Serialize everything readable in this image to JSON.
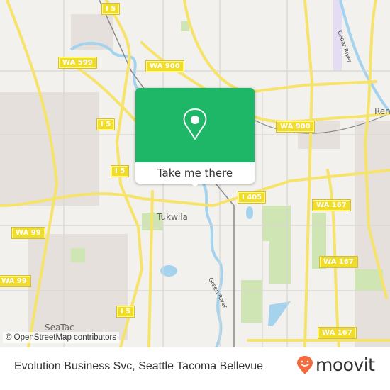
{
  "map": {
    "road_shields": [
      {
        "id": "i5-top",
        "label": "I 5"
      },
      {
        "id": "wa599",
        "label": "WA 599"
      },
      {
        "id": "wa900-left",
        "label": "WA 900"
      },
      {
        "id": "i5-mid",
        "label": "I 5"
      },
      {
        "id": "i5-upper-mid",
        "label": "I 5"
      },
      {
        "id": "wa900-right",
        "label": "WA 900"
      },
      {
        "id": "i405",
        "label": "I 405"
      },
      {
        "id": "wa167-top",
        "label": "WA 167"
      },
      {
        "id": "wa99-upper",
        "label": "WA 99"
      },
      {
        "id": "wa167-mid",
        "label": "WA 167"
      },
      {
        "id": "wa99-lower",
        "label": "WA 99"
      },
      {
        "id": "i5-lower",
        "label": "I 5"
      },
      {
        "id": "wa167-bottom",
        "label": "WA 167"
      }
    ],
    "places": {
      "tukwila": "Tukwila",
      "seatac": "SeaTac",
      "renton": "Ren"
    },
    "rivers": {
      "cedar": "Cedar River",
      "green": "Green River"
    },
    "colors": {
      "land": "#f2f1ee",
      "water": "#a5d3ee",
      "highway": "#f6e36b",
      "park": "#cfe6b4",
      "popup_green": "#1db767",
      "moovit_orange": "#f26a3d"
    }
  },
  "popup": {
    "icon": "location-pin-icon",
    "button_label": "Take me there"
  },
  "attribution": "© OpenStreetMap contributors",
  "footer": {
    "title": "Evolution Business Svc, Seattle Tacoma Bellevue",
    "logo_text": "moovit"
  }
}
